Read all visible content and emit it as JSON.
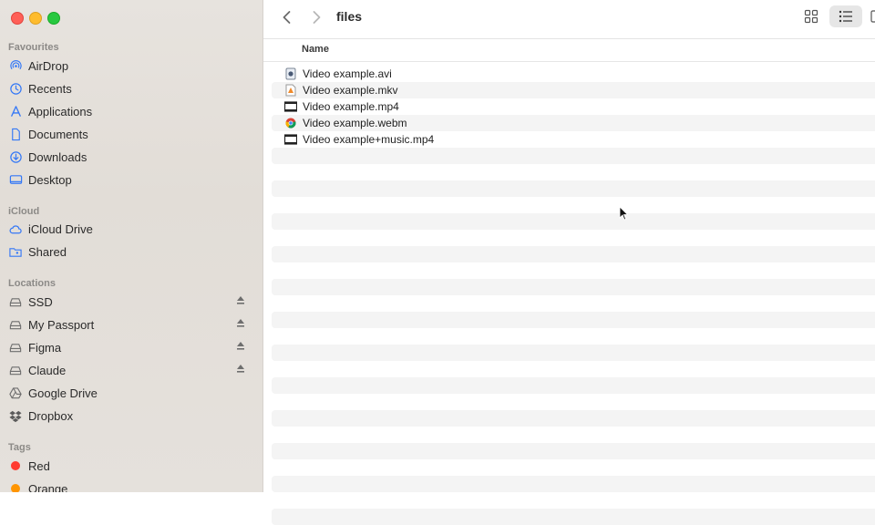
{
  "window": {
    "title": "files"
  },
  "sidebar": {
    "favourites_title": "Favourites",
    "favourites": [
      {
        "label": "AirDrop",
        "icon": "airdrop-icon"
      },
      {
        "label": "Recents",
        "icon": "clock-icon"
      },
      {
        "label": "Applications",
        "icon": "applications-icon"
      },
      {
        "label": "Documents",
        "icon": "document-icon"
      },
      {
        "label": "Downloads",
        "icon": "download-icon"
      },
      {
        "label": "Desktop",
        "icon": "desktop-icon"
      }
    ],
    "icloud_title": "iCloud",
    "icloud": [
      {
        "label": "iCloud Drive",
        "icon": "cloud-icon"
      },
      {
        "label": "Shared",
        "icon": "shared-folder-icon"
      }
    ],
    "locations_title": "Locations",
    "locations": [
      {
        "label": "SSD",
        "icon": "drive-icon",
        "ejectable": true
      },
      {
        "label": "My Passport",
        "icon": "drive-icon",
        "ejectable": true
      },
      {
        "label": "Figma",
        "icon": "drive-icon",
        "ejectable": true
      },
      {
        "label": "Claude",
        "icon": "drive-icon",
        "ejectable": true
      },
      {
        "label": "Google Drive",
        "icon": "google-drive-icon",
        "ejectable": false
      },
      {
        "label": "Dropbox",
        "icon": "dropbox-icon",
        "ejectable": false
      }
    ],
    "tags_title": "Tags",
    "tags": [
      {
        "label": "Red",
        "color": "#ff3b30"
      },
      {
        "label": "Orange",
        "color": "#ff9500"
      }
    ]
  },
  "toolbar": {
    "view_icons": "grid-view-icon",
    "view_list": "list-view-icon"
  },
  "list": {
    "column_name": "Name",
    "files": [
      {
        "name": "Video example.avi",
        "icon": "avi-file-icon"
      },
      {
        "name": "Video example.mkv",
        "icon": "mkv-file-icon"
      },
      {
        "name": "Video example.mp4",
        "icon": "mp4-file-icon"
      },
      {
        "name": "Video example.webm",
        "icon": "chrome-file-icon"
      },
      {
        "name": "Video example+music.mp4",
        "icon": "mp4-file-icon"
      }
    ]
  },
  "colors": {
    "accent": "#3478f6",
    "sidebar_text": "#2a2a2a",
    "section_title": "#8c8a87"
  }
}
